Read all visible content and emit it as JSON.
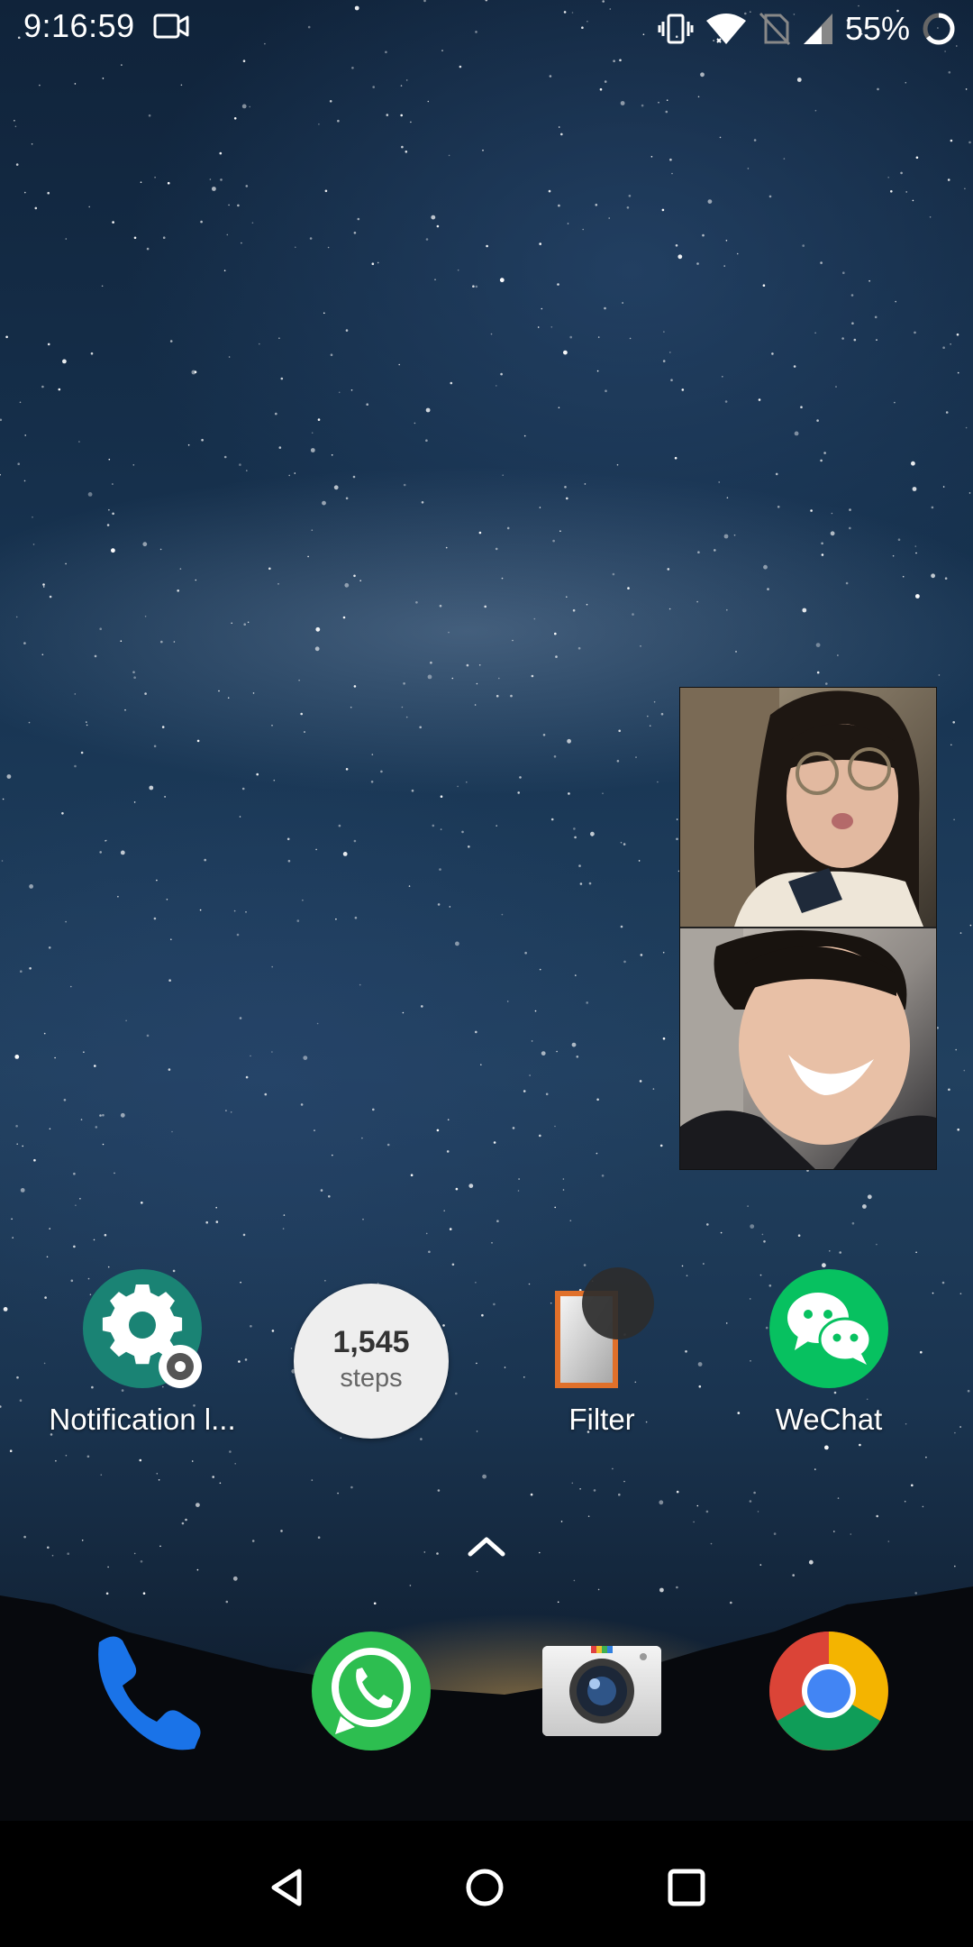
{
  "status_bar": {
    "time": "9:16:59",
    "battery_percent": "55%",
    "icons": [
      "video-call-icon",
      "vibrate-icon",
      "wifi-icon",
      "no-sim-icon",
      "cell-signal-icon",
      "battery-saver-icon"
    ]
  },
  "home": {
    "apps": [
      {
        "label": "Notification l...",
        "icon": "settings-gear-icon"
      },
      {
        "label": "Filter",
        "icon": "filter-icon"
      },
      {
        "label": "WeChat",
        "icon": "wechat-icon"
      }
    ],
    "steps_widget": {
      "count": "1,545",
      "unit": "steps"
    }
  },
  "dock": {
    "apps": [
      {
        "name": "Phone",
        "icon": "phone-icon"
      },
      {
        "name": "WhatsApp",
        "icon": "whatsapp-icon"
      },
      {
        "name": "Camera",
        "icon": "camera-icon"
      },
      {
        "name": "Chrome",
        "icon": "chrome-icon"
      }
    ]
  },
  "colors": {
    "notification_teal": "#1a8374",
    "wechat_green": "#07c160",
    "whatsapp_green": "#2dbe50",
    "phone_blue": "#1a73e8",
    "filter_orange": "#e0702a"
  }
}
